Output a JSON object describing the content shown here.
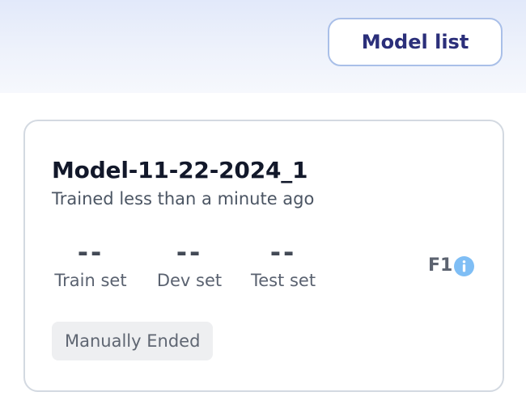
{
  "header": {
    "model_list_label": "Model list"
  },
  "card": {
    "model_name": "Model-11-22-2024_1",
    "trained_text": "Trained less than a minute ago",
    "metrics": [
      {
        "value": "--",
        "label": "Train set"
      },
      {
        "value": "--",
        "label": "Dev set"
      },
      {
        "value": "--",
        "label": "Test set"
      }
    ],
    "metric_name": "F1",
    "info_icon": "info-icon",
    "status": "Manually Ended"
  },
  "colors": {
    "accent_text": "#2b2f7a",
    "button_border": "#a9bfe8",
    "info_icon": "#7fbef5",
    "badge_bg": "#eeeff1"
  }
}
